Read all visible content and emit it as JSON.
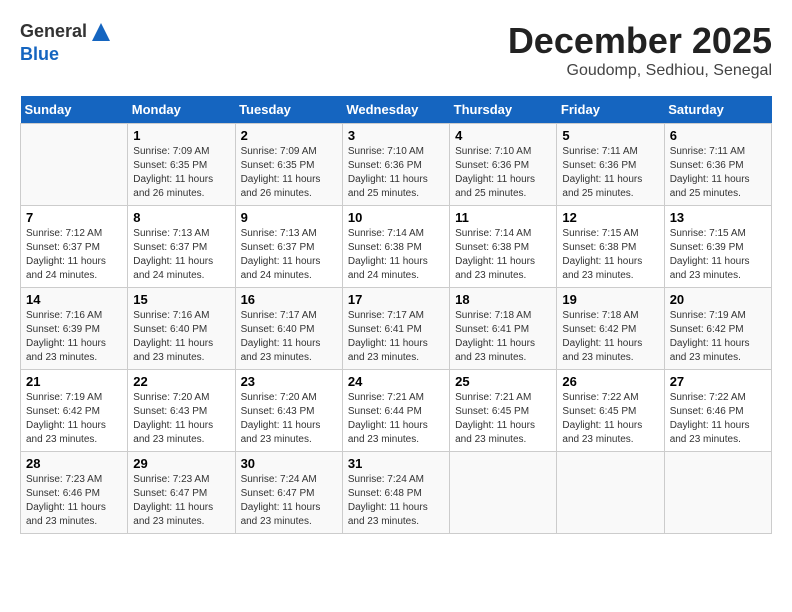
{
  "header": {
    "logo_line1": "General",
    "logo_line2": "Blue",
    "month": "December 2025",
    "location": "Goudomp, Sedhiou, Senegal"
  },
  "days_of_week": [
    "Sunday",
    "Monday",
    "Tuesday",
    "Wednesday",
    "Thursday",
    "Friday",
    "Saturday"
  ],
  "weeks": [
    [
      {
        "day": "",
        "info": ""
      },
      {
        "day": "1",
        "info": "Sunrise: 7:09 AM\nSunset: 6:35 PM\nDaylight: 11 hours\nand 26 minutes."
      },
      {
        "day": "2",
        "info": "Sunrise: 7:09 AM\nSunset: 6:35 PM\nDaylight: 11 hours\nand 26 minutes."
      },
      {
        "day": "3",
        "info": "Sunrise: 7:10 AM\nSunset: 6:36 PM\nDaylight: 11 hours\nand 25 minutes."
      },
      {
        "day": "4",
        "info": "Sunrise: 7:10 AM\nSunset: 6:36 PM\nDaylight: 11 hours\nand 25 minutes."
      },
      {
        "day": "5",
        "info": "Sunrise: 7:11 AM\nSunset: 6:36 PM\nDaylight: 11 hours\nand 25 minutes."
      },
      {
        "day": "6",
        "info": "Sunrise: 7:11 AM\nSunset: 6:36 PM\nDaylight: 11 hours\nand 25 minutes."
      }
    ],
    [
      {
        "day": "7",
        "info": "Sunrise: 7:12 AM\nSunset: 6:37 PM\nDaylight: 11 hours\nand 24 minutes."
      },
      {
        "day": "8",
        "info": "Sunrise: 7:13 AM\nSunset: 6:37 PM\nDaylight: 11 hours\nand 24 minutes."
      },
      {
        "day": "9",
        "info": "Sunrise: 7:13 AM\nSunset: 6:37 PM\nDaylight: 11 hours\nand 24 minutes."
      },
      {
        "day": "10",
        "info": "Sunrise: 7:14 AM\nSunset: 6:38 PM\nDaylight: 11 hours\nand 24 minutes."
      },
      {
        "day": "11",
        "info": "Sunrise: 7:14 AM\nSunset: 6:38 PM\nDaylight: 11 hours\nand 23 minutes."
      },
      {
        "day": "12",
        "info": "Sunrise: 7:15 AM\nSunset: 6:38 PM\nDaylight: 11 hours\nand 23 minutes."
      },
      {
        "day": "13",
        "info": "Sunrise: 7:15 AM\nSunset: 6:39 PM\nDaylight: 11 hours\nand 23 minutes."
      }
    ],
    [
      {
        "day": "14",
        "info": "Sunrise: 7:16 AM\nSunset: 6:39 PM\nDaylight: 11 hours\nand 23 minutes."
      },
      {
        "day": "15",
        "info": "Sunrise: 7:16 AM\nSunset: 6:40 PM\nDaylight: 11 hours\nand 23 minutes."
      },
      {
        "day": "16",
        "info": "Sunrise: 7:17 AM\nSunset: 6:40 PM\nDaylight: 11 hours\nand 23 minutes."
      },
      {
        "day": "17",
        "info": "Sunrise: 7:17 AM\nSunset: 6:41 PM\nDaylight: 11 hours\nand 23 minutes."
      },
      {
        "day": "18",
        "info": "Sunrise: 7:18 AM\nSunset: 6:41 PM\nDaylight: 11 hours\nand 23 minutes."
      },
      {
        "day": "19",
        "info": "Sunrise: 7:18 AM\nSunset: 6:42 PM\nDaylight: 11 hours\nand 23 minutes."
      },
      {
        "day": "20",
        "info": "Sunrise: 7:19 AM\nSunset: 6:42 PM\nDaylight: 11 hours\nand 23 minutes."
      }
    ],
    [
      {
        "day": "21",
        "info": "Sunrise: 7:19 AM\nSunset: 6:42 PM\nDaylight: 11 hours\nand 23 minutes."
      },
      {
        "day": "22",
        "info": "Sunrise: 7:20 AM\nSunset: 6:43 PM\nDaylight: 11 hours\nand 23 minutes."
      },
      {
        "day": "23",
        "info": "Sunrise: 7:20 AM\nSunset: 6:43 PM\nDaylight: 11 hours\nand 23 minutes."
      },
      {
        "day": "24",
        "info": "Sunrise: 7:21 AM\nSunset: 6:44 PM\nDaylight: 11 hours\nand 23 minutes."
      },
      {
        "day": "25",
        "info": "Sunrise: 7:21 AM\nSunset: 6:45 PM\nDaylight: 11 hours\nand 23 minutes."
      },
      {
        "day": "26",
        "info": "Sunrise: 7:22 AM\nSunset: 6:45 PM\nDaylight: 11 hours\nand 23 minutes."
      },
      {
        "day": "27",
        "info": "Sunrise: 7:22 AM\nSunset: 6:46 PM\nDaylight: 11 hours\nand 23 minutes."
      }
    ],
    [
      {
        "day": "28",
        "info": "Sunrise: 7:23 AM\nSunset: 6:46 PM\nDaylight: 11 hours\nand 23 minutes."
      },
      {
        "day": "29",
        "info": "Sunrise: 7:23 AM\nSunset: 6:47 PM\nDaylight: 11 hours\nand 23 minutes."
      },
      {
        "day": "30",
        "info": "Sunrise: 7:24 AM\nSunset: 6:47 PM\nDaylight: 11 hours\nand 23 minutes."
      },
      {
        "day": "31",
        "info": "Sunrise: 7:24 AM\nSunset: 6:48 PM\nDaylight: 11 hours\nand 23 minutes."
      },
      {
        "day": "",
        "info": ""
      },
      {
        "day": "",
        "info": ""
      },
      {
        "day": "",
        "info": ""
      }
    ]
  ]
}
